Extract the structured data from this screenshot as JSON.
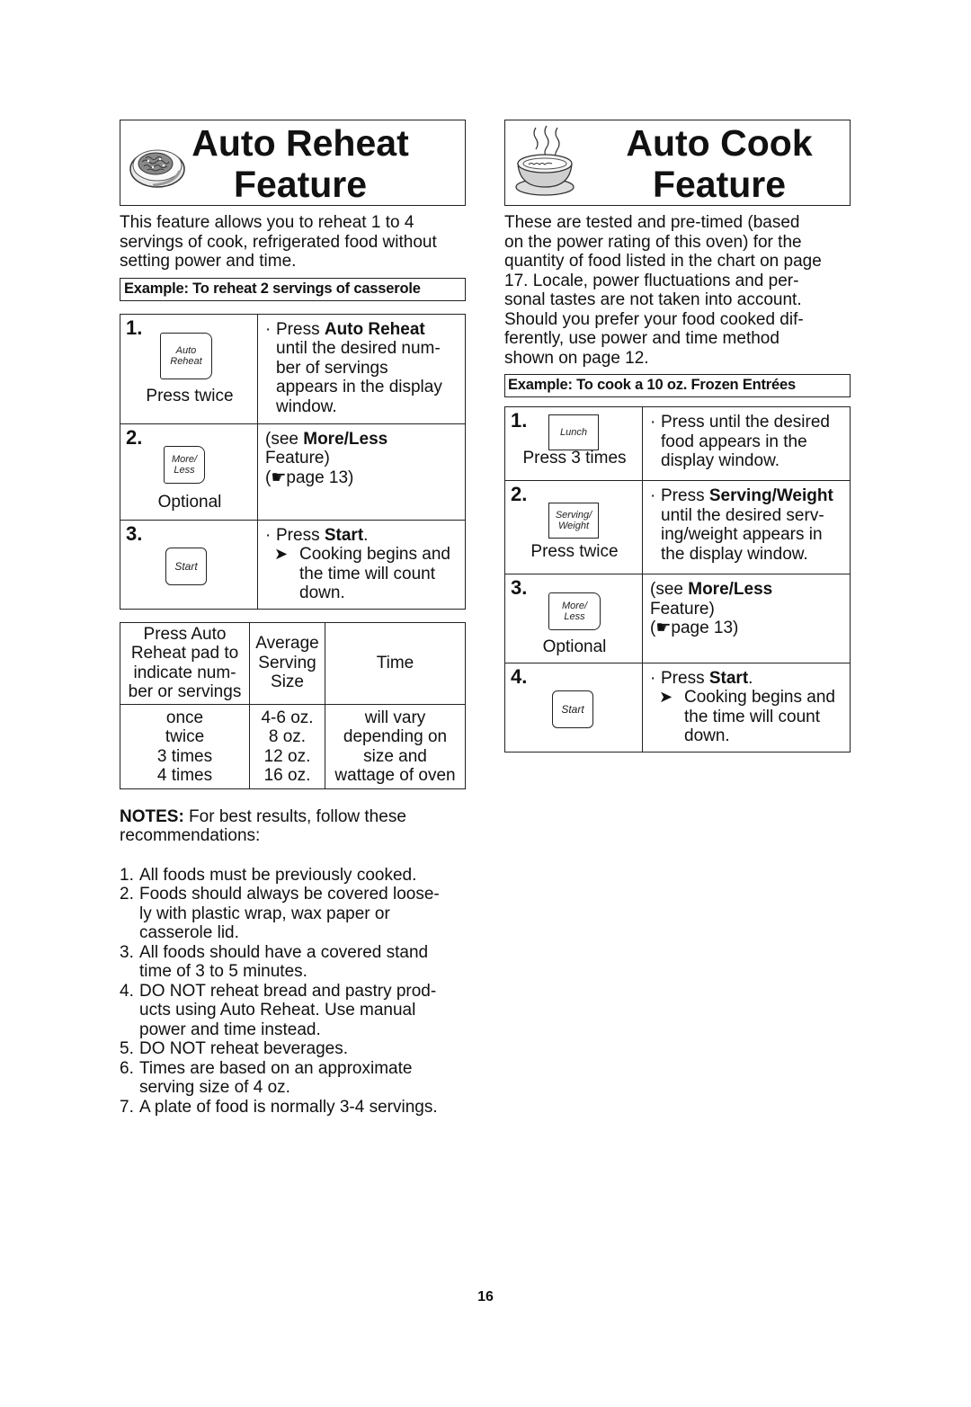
{
  "page_number": "16",
  "auto_reheat": {
    "title_line1": "Auto Reheat",
    "title_line2": "Feature",
    "icon": "plate-of-food-icon",
    "intro": "This feature allows you to reheat 1 to 4 servings of cook, refrigerated food without setting power and time.",
    "intro_lines": [
      "This feature allows you to reheat 1 to 4",
      "servings of cook, refrigerated food without",
      "setting power and time."
    ],
    "example": "Example: To reheat  2 servings of casserole",
    "steps": [
      {
        "num": "1.",
        "pad_line1": "Auto",
        "pad_line2": "Reheat",
        "caption": "Press twice",
        "prefix": "Press ",
        "bold": "Auto Reheat",
        "rest_lines": [
          "until the desired num-",
          "ber of servings",
          "appears in the display",
          "window."
        ]
      },
      {
        "num": "2.",
        "pad_line1": "More/",
        "pad_line2": "Less",
        "caption": "Optional",
        "see_prefix": "(see ",
        "bold": "More/Less",
        "line2": "Feature)",
        "line3_open": "(",
        "pointer": "☛",
        "line3_rest": "page 13)"
      },
      {
        "num": "3.",
        "pad_line1": "Start",
        "prefix": "Press ",
        "bold": "Start",
        "suffix": ".",
        "arrow": "➤",
        "result_lines": [
          "Cooking begins and",
          "the time will count",
          "down."
        ]
      }
    ],
    "chart": {
      "headers": [
        [
          "Press Auto",
          "Reheat pad to",
          "indicate num-",
          "ber or servings"
        ],
        [
          "Average",
          "Serving",
          "Size"
        ],
        [
          "Time"
        ]
      ],
      "presses": [
        "once",
        "twice",
        "3 times",
        "4 times"
      ],
      "sizes": [
        "4-6 oz.",
        "8 oz.",
        "12 oz.",
        "16 oz."
      ],
      "time_lines": [
        "will vary",
        "depending on",
        "size and",
        "wattage of oven"
      ]
    },
    "notes": {
      "label": "NOTES:",
      "intro": " For best results, follow these",
      "intro2": "recommendations:",
      "items": [
        {
          "num": "1.",
          "lines": [
            "All foods must be previously cooked."
          ]
        },
        {
          "num": "2.",
          "lines": [
            "Foods should always be covered loose-",
            "ly with plastic wrap, wax paper or",
            "casserole lid."
          ]
        },
        {
          "num": "3.",
          "lines": [
            "All foods should have a covered stand",
            "time of 3 to 5 minutes."
          ]
        },
        {
          "num": "4.",
          "lines": [
            "DO NOT reheat bread and pastry prod-",
            "ucts using Auto Reheat. Use manual",
            "power and time instead."
          ]
        },
        {
          "num": "5.",
          "lines": [
            "DO NOT reheat beverages."
          ]
        },
        {
          "num": "6.",
          "lines": [
            "Times are based on an approximate",
            "serving size of 4 oz."
          ]
        },
        {
          "num": "7.",
          "lines": [
            "A plate of food is normally 3-4 servings."
          ]
        }
      ]
    }
  },
  "auto_cook": {
    "title_line1": "Auto Cook",
    "title_line2": "Feature",
    "icon": "steaming-bowl-icon",
    "intro_lines": [
      "These are tested and pre-timed (based",
      "on the power rating of this oven) for the",
      "quantity of food listed in the chart on page",
      "17. Locale, power fluctuations and per-",
      "sonal tastes are not taken into account.",
      "Should you prefer your food cooked dif-",
      "ferently, use power and time method",
      "shown on page 12."
    ],
    "example": "Example: To cook a 10 oz. Frozen Entrées",
    "steps": [
      {
        "num": "1.",
        "pad_line1": "Lunch",
        "caption": "Press 3 times",
        "lines": [
          "Press until the desired",
          "food appears in the",
          "display window."
        ]
      },
      {
        "num": "2.",
        "pad_line1": "Serving/",
        "pad_line2": "Weight",
        "caption": "Press twice",
        "prefix": "Press ",
        "bold": "Serving/Weight",
        "rest_lines": [
          "until the desired serv-",
          "ing/weight appears in",
          "the display window."
        ]
      },
      {
        "num": "3.",
        "pad_line1": "More/",
        "pad_line2": "Less",
        "caption": "Optional",
        "see_prefix": "(see ",
        "bold": "More/Less",
        "line2": "Feature)",
        "line3_open": "(",
        "pointer": "☛",
        "line3_rest": "page 13)"
      },
      {
        "num": "4.",
        "pad_line1": "Start",
        "prefix": "Press ",
        "bold": "Start",
        "suffix": ".",
        "arrow": "➤",
        "result_lines": [
          "Cooking begins and",
          "the time will count",
          "down."
        ]
      }
    ]
  }
}
